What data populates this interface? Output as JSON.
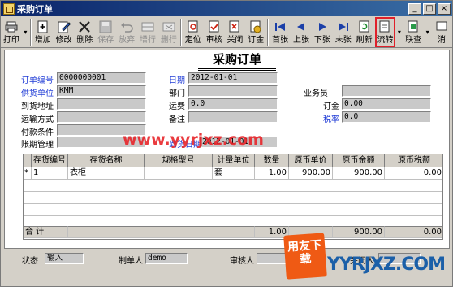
{
  "window": {
    "title": "采购订单",
    "min": "_",
    "max": "□",
    "close": "×"
  },
  "toolbar": {
    "buttons": [
      {
        "label": "打印",
        "icon": "printer-icon"
      },
      {
        "label": "增加",
        "icon": "add-document-icon"
      },
      {
        "label": "修改",
        "icon": "edit-icon"
      },
      {
        "label": "删除",
        "icon": "delete-icon"
      },
      {
        "label": "保存",
        "icon": "save-icon"
      },
      {
        "label": "放弃",
        "icon": "undo-icon"
      },
      {
        "label": "增行",
        "icon": "add-row-icon"
      },
      {
        "label": "删行",
        "icon": "delete-row-icon"
      },
      {
        "label": "定位",
        "icon": "locate-icon"
      },
      {
        "label": "审核",
        "icon": "audit-icon"
      },
      {
        "label": "关闭",
        "icon": "close-document-icon"
      },
      {
        "label": "订金",
        "icon": "deposit-icon"
      },
      {
        "label": "首张",
        "icon": "first-record-icon"
      },
      {
        "label": "上张",
        "icon": "previous-record-icon"
      },
      {
        "label": "下张",
        "icon": "next-record-icon"
      },
      {
        "label": "末张",
        "icon": "last-record-icon"
      },
      {
        "label": "刷新",
        "icon": "refresh-icon"
      },
      {
        "label": "流转",
        "icon": "flow-icon"
      },
      {
        "label": "联查",
        "icon": "linked-query-icon"
      },
      {
        "label": "消",
        "icon": "message-icon"
      }
    ]
  },
  "form": {
    "title": "采购订单",
    "order_no_label": "订单编号",
    "order_no": "0000000001",
    "date_label": "日期",
    "date": "2012-01-01",
    "supplier_label": "供货单位",
    "supplier": "KMM",
    "dept_label": "部门",
    "dept": "",
    "salesman_label": "业务员",
    "salesman": "",
    "address_label": "到货地址",
    "address": "",
    "freight_label": "运费",
    "freight": "0.0",
    "deposit_label": "订金",
    "deposit": "0.00",
    "transport_label": "运输方式",
    "transport": "",
    "remark_label": "备注",
    "remark": "",
    "taxrate_label": "税率",
    "taxrate": "0.0",
    "payment_label": "付款条件",
    "payment": "",
    "arrival_label": "到货日期",
    "arrival": "2012-01-01",
    "period_label": "账期管理",
    "period": ""
  },
  "grid": {
    "headers": [
      "存货编号",
      "存货名称",
      "规格型号",
      "计量单位",
      "数量",
      "原币单价",
      "原币金额",
      "原币税额"
    ],
    "rows": [
      {
        "marker": "*",
        "code": "1",
        "name": "衣柜",
        "spec": "",
        "unit": "套",
        "qty": "1.00",
        "price": "900.00",
        "amount": "900.00",
        "tax": "0.00"
      }
    ],
    "total_label": "合 计",
    "total_qty": "1.00",
    "total_amount": "900.00",
    "total_tax": "0.00"
  },
  "footer": {
    "status_label": "状态",
    "status": "输入",
    "creator_label": "制单人",
    "creator": "demo",
    "auditor_label": "审核人",
    "auditor": "",
    "closer_label": "关闭人",
    "closer": ""
  },
  "watermarks": {
    "url_text": "www.yyrjxz.com",
    "logo_text": "用友下载",
    "brand_text": "YYRJXZ.COM"
  },
  "colors": {
    "title_bar": "#0a246a",
    "highlight": "#e0202a",
    "label_blue": "#1f3bd6"
  }
}
